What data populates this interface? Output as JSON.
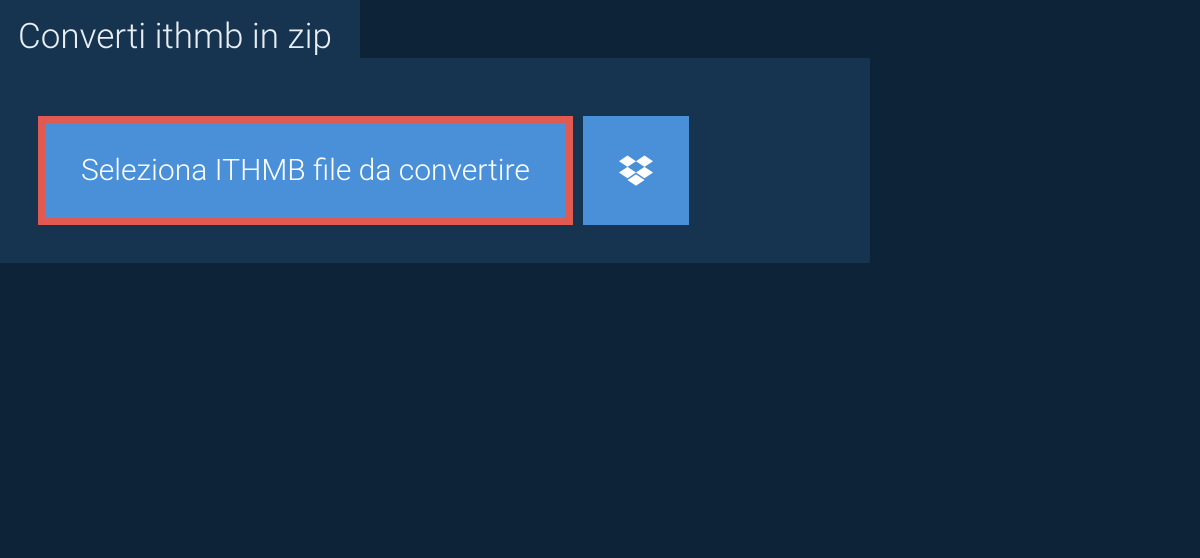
{
  "tab": {
    "label": "Converti ithmb in zip"
  },
  "buttons": {
    "select_file_label": "Seleziona ITHMB file da convertire"
  },
  "colors": {
    "background": "#0d2438",
    "panel": "#163450",
    "button_bg": "#4a90d9",
    "button_border": "#e05a52"
  }
}
